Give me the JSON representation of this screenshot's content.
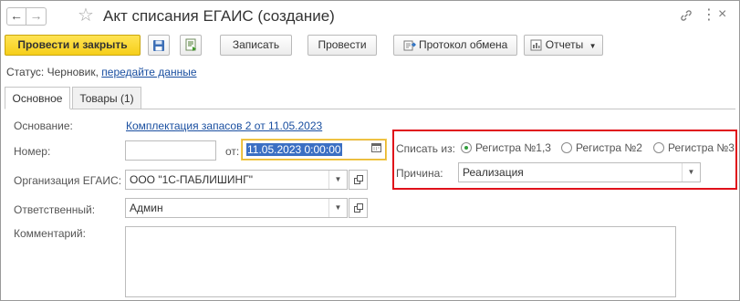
{
  "window": {
    "title": "Акт списания ЕГАИС (создание)",
    "nav_back": "←",
    "nav_forward": "→",
    "favorite": "☆",
    "link_icon": "link-icon",
    "more_icon": "more-icon"
  },
  "toolbar": {
    "post_and_close": "Провести и закрыть",
    "save_icon": "floppy-disk-icon",
    "report_icon": "document-report-icon",
    "write": "Записать",
    "post": "Провести",
    "exchange_protocol": "Протокол обмена",
    "reports": "Отчеты"
  },
  "status": {
    "label": "Статус:",
    "value": "Черновик,",
    "link": "передайте данные"
  },
  "tabs": [
    {
      "label": "Основное",
      "active": true
    },
    {
      "label": "Товары (1)",
      "active": false
    }
  ],
  "form": {
    "basis_label": "Основание:",
    "basis_link": "Комплектация запасов 2 от 11.05.2023",
    "number_label": "Номер:",
    "number_value": "",
    "date_label": "от:",
    "date_value": "11.05.2023  0:00:00",
    "org_label": "Организация ЕГАИС:",
    "org_value": "ООО \"1С-ПАБЛИШИНГ\"",
    "responsible_label": "Ответственный:",
    "responsible_value": "Админ",
    "comment_label": "Комментарий:",
    "comment_value": "",
    "writeoff_label": "Списать из:",
    "writeoff_options": [
      {
        "label": "Регистра №1,3",
        "selected": true
      },
      {
        "label": "Регистра №2",
        "selected": false
      },
      {
        "label": "Регистра №3",
        "selected": false
      }
    ],
    "reason_label": "Причина:",
    "reason_value": "Реализация"
  },
  "colors": {
    "primary_button": "#f6cf1a",
    "link": "#1a4fa0",
    "highlight_frame": "#e0101a",
    "radio_selected": "#2f9e3b",
    "date_selection": "#3b6fc3"
  }
}
